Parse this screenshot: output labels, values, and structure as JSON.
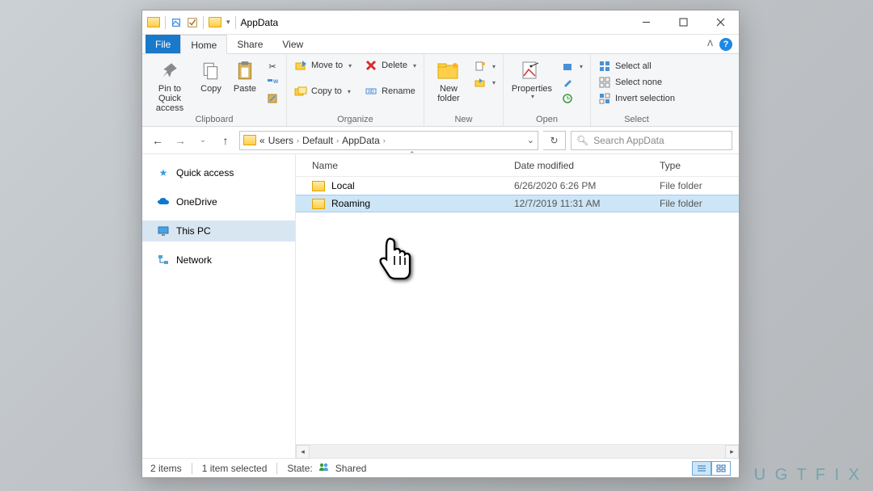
{
  "title": "AppData",
  "menutabs": {
    "file": "File",
    "home": "Home",
    "share": "Share",
    "view": "View"
  },
  "ribbon": {
    "clipboard": {
      "label": "Clipboard",
      "pin": "Pin to Quick\naccess",
      "copy": "Copy",
      "paste": "Paste"
    },
    "organize": {
      "label": "Organize",
      "moveto": "Move to",
      "copyto": "Copy to",
      "delete": "Delete",
      "rename": "Rename"
    },
    "new": {
      "label": "New",
      "newfolder": "New\nfolder"
    },
    "open": {
      "label": "Open",
      "properties": "Properties"
    },
    "select": {
      "label": "Select",
      "all": "Select all",
      "none": "Select none",
      "invert": "Invert selection"
    }
  },
  "breadcrumb": {
    "ell": "«",
    "p1": "Users",
    "p2": "Default",
    "p3": "AppData"
  },
  "search_placeholder": "Search AppData",
  "sidebar": {
    "quick": "Quick access",
    "onedrive": "OneDrive",
    "thispc": "This PC",
    "network": "Network"
  },
  "columns": {
    "name": "Name",
    "date": "Date modified",
    "type": "Type"
  },
  "rows": [
    {
      "name": "Local",
      "date": "6/26/2020 6:26 PM",
      "type": "File folder"
    },
    {
      "name": "Roaming",
      "date": "12/7/2019 11:31 AM",
      "type": "File folder"
    }
  ],
  "status": {
    "items": "2 items",
    "selected": "1 item selected",
    "state_label": "State:",
    "state_value": "Shared"
  }
}
